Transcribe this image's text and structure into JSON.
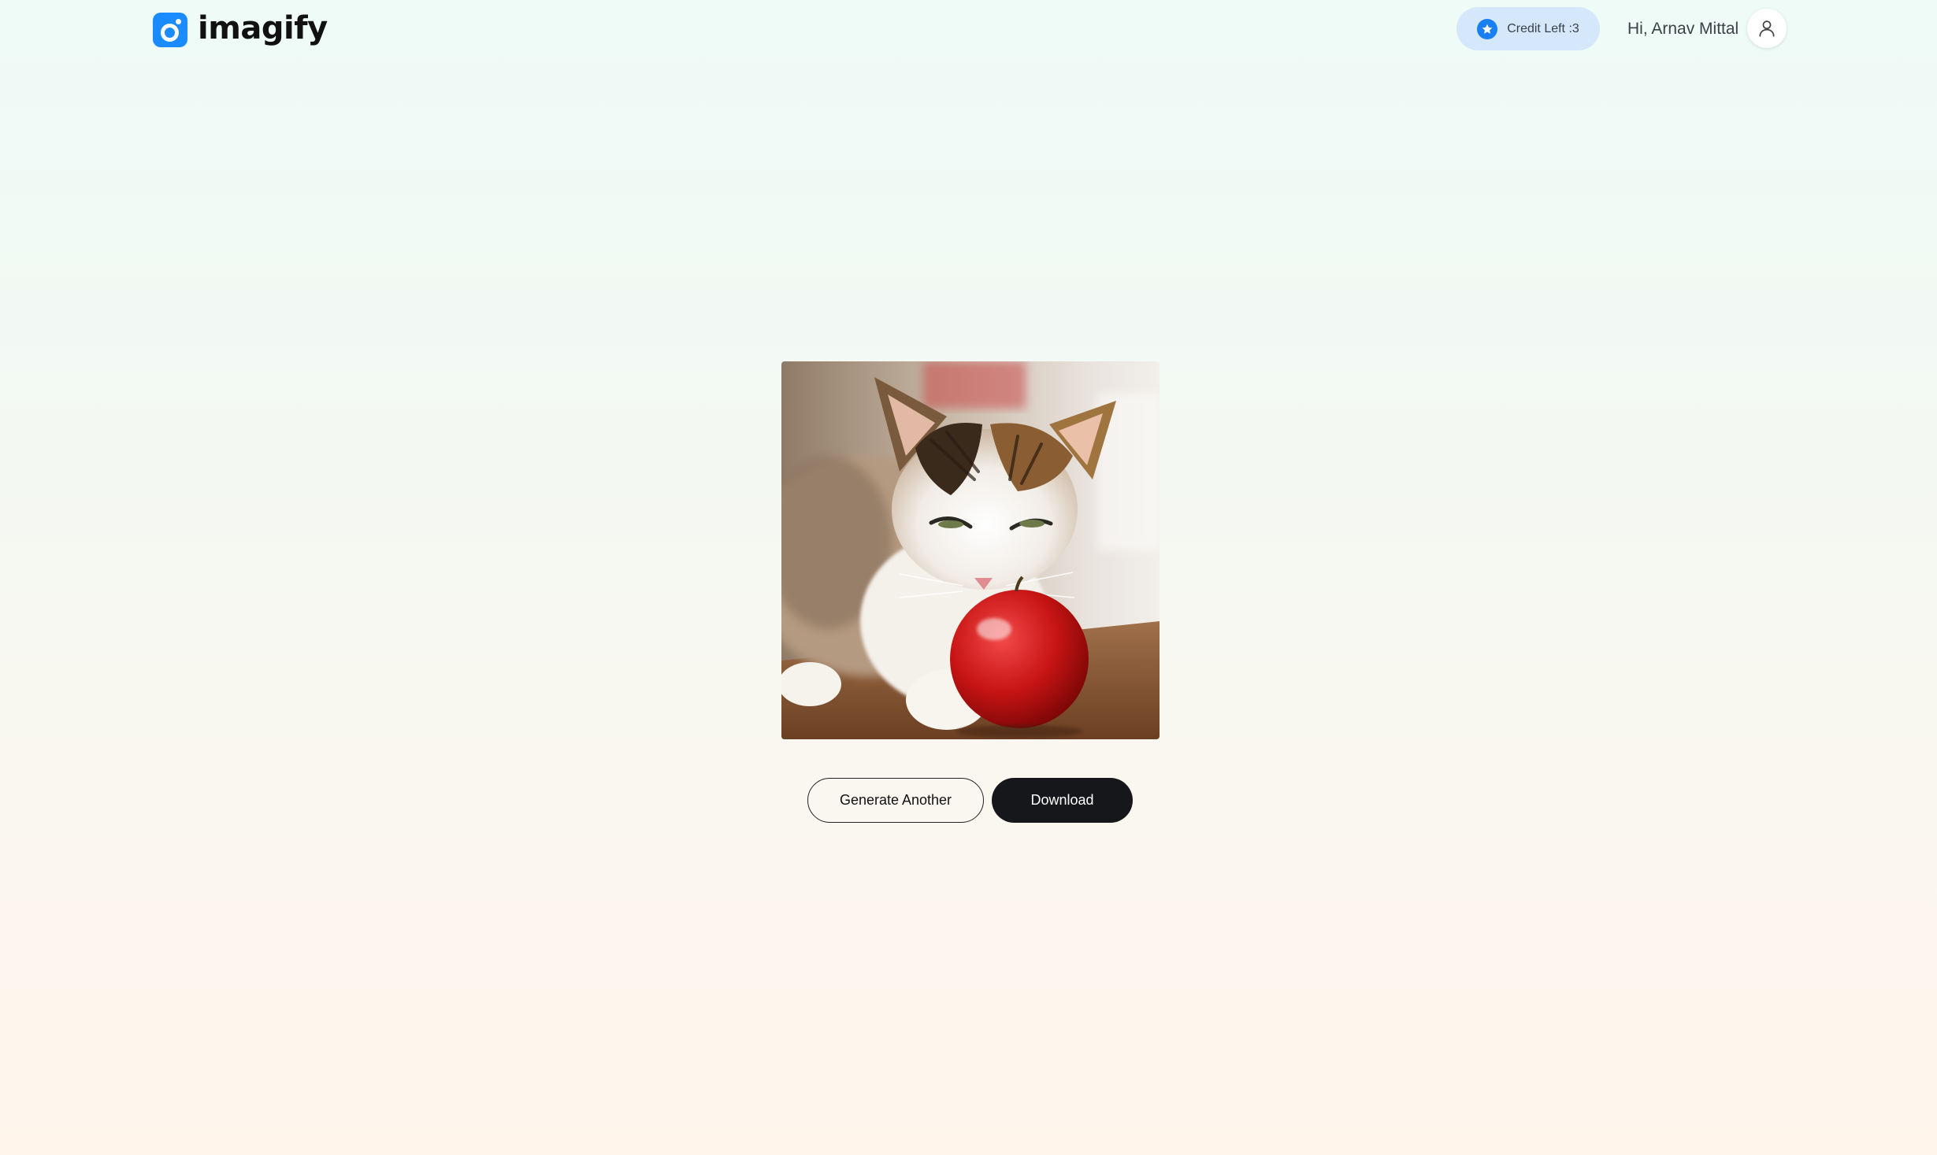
{
  "header": {
    "brand_name": "imagify",
    "credit_label": "Credit Left :3",
    "greeting": "Hi, Arnav Mittal"
  },
  "result": {
    "image_subject": "cat-with-red-apple"
  },
  "actions": {
    "generate_another_label": "Generate Another",
    "download_label": "Download"
  },
  "icons": {
    "logo": "imagify-logo-icon",
    "credit": "star-badge-icon",
    "avatar": "user-profile-icon"
  },
  "colors": {
    "brand_blue": "#1a8cff",
    "credit_pill_bg": "#d5e8fb",
    "primary_button_bg": "#16171a",
    "page_gradient_top": "#eefbf7",
    "page_gradient_bottom": "#fff5eb"
  }
}
